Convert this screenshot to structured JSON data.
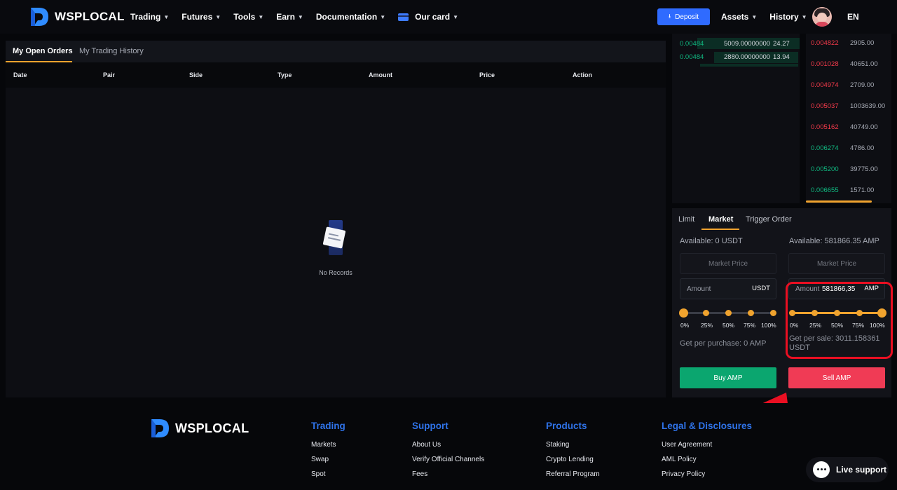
{
  "brand": {
    "name": "WSPLOCAL",
    "accent": "#2f6bff",
    "highlight": "#f0a32e"
  },
  "nav": {
    "items": [
      {
        "label": "Trading"
      },
      {
        "label": "Futures"
      },
      {
        "label": "Tools"
      },
      {
        "label": "Earn"
      },
      {
        "label": "Documentation"
      }
    ],
    "card_label": "Our card",
    "deposit_label": "Deposit",
    "assets_label": "Assets",
    "history_label": "History",
    "language": "EN"
  },
  "orders": {
    "tabs": [
      "My Open Orders",
      "My Trading History"
    ],
    "columns": [
      "Date",
      "Pair",
      "Side",
      "Type",
      "Amount",
      "Price",
      "Action"
    ],
    "empty_text": "No Records"
  },
  "orderbook": {
    "bids": [
      {
        "price": "0.00484",
        "amount": "5009.00000000",
        "total": "24.27"
      },
      {
        "price": "0.00484",
        "amount": "2880.00000000",
        "total": "13.94"
      }
    ],
    "trades": [
      {
        "price": "0.004822",
        "amount": "2905.00",
        "side": "sell"
      },
      {
        "price": "0.001028",
        "amount": "40651.00",
        "side": "sell"
      },
      {
        "price": "0.004974",
        "amount": "2709.00",
        "side": "sell"
      },
      {
        "price": "0.005037",
        "amount": "1003639.00",
        "side": "sell"
      },
      {
        "price": "0.005162",
        "amount": "40749.00",
        "side": "sell"
      },
      {
        "price": "0.006274",
        "amount": "4786.00",
        "side": "buy"
      },
      {
        "price": "0.005200",
        "amount": "39775.00",
        "side": "buy"
      },
      {
        "price": "0.006655",
        "amount": "1571.00",
        "side": "buy"
      }
    ]
  },
  "trade": {
    "tabs": [
      "Limit",
      "Market",
      "Trigger Order"
    ],
    "active_tab": "Market",
    "buy": {
      "available": "Available: 0  USDT",
      "price_placeholder": "Market Price",
      "amount_label": "Amount",
      "amount_unit": "USDT",
      "slider_fraction": 0,
      "get_text": "Get per purchase: 0  AMP",
      "button": "Buy AMP"
    },
    "sell": {
      "available": "Available: 581866.35  AMP",
      "price_placeholder": "Market Price",
      "amount_label": "Amount",
      "amount_value": "581866,35",
      "amount_unit": "AMP",
      "slider_fraction": 1,
      "get_text_line1": "Get per sale: 3011.158361",
      "get_text_line2": "USDT",
      "button": "Sell AMP"
    },
    "percent_marks": [
      "0%",
      "25%",
      "50%",
      "75%",
      "100%"
    ]
  },
  "footer": {
    "columns": [
      {
        "title": "Trading",
        "links": [
          "Markets",
          "Swap",
          "Spot"
        ]
      },
      {
        "title": "Support",
        "links": [
          "About Us",
          "Verify Official Channels",
          "Fees"
        ]
      },
      {
        "title": "Products",
        "links": [
          "Staking",
          "Crypto Lending",
          "Referral Program"
        ]
      },
      {
        "title": "Legal & Disclosures",
        "links": [
          "User Agreement",
          "AML Policy",
          "Privacy Policy"
        ]
      }
    ]
  },
  "live_support": "Live support"
}
